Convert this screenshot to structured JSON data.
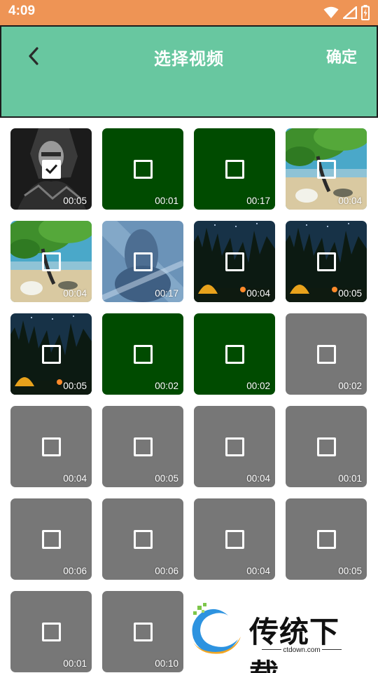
{
  "status_bar": {
    "time": "4:09"
  },
  "header": {
    "title": "选择视频",
    "confirm_label": "确定"
  },
  "colors": {
    "status_bar": "#ee9455",
    "header": "#68c7a0",
    "green_tile": "#004b00",
    "gray_tile": "#777777"
  },
  "videos": [
    {
      "duration": "00:05",
      "thumbnail": "dark-portrait",
      "selected": true
    },
    {
      "duration": "00:01",
      "thumbnail": "green",
      "selected": false
    },
    {
      "duration": "00:17",
      "thumbnail": "green",
      "selected": false
    },
    {
      "duration": "00:04",
      "thumbnail": "beach-tree",
      "selected": false
    },
    {
      "duration": "00:04",
      "thumbnail": "beach-tree",
      "selected": false
    },
    {
      "duration": "00:17",
      "thumbnail": "blue-figure",
      "selected": false
    },
    {
      "duration": "00:04",
      "thumbnail": "night-tent",
      "selected": false
    },
    {
      "duration": "00:05",
      "thumbnail": "night-tent",
      "selected": false
    },
    {
      "duration": "00:05",
      "thumbnail": "night-tent",
      "selected": false
    },
    {
      "duration": "00:02",
      "thumbnail": "green",
      "selected": false
    },
    {
      "duration": "00:02",
      "thumbnail": "green",
      "selected": false
    },
    {
      "duration": "00:02",
      "thumbnail": "gray",
      "selected": false
    },
    {
      "duration": "00:04",
      "thumbnail": "gray",
      "selected": false
    },
    {
      "duration": "00:05",
      "thumbnail": "gray",
      "selected": false
    },
    {
      "duration": "00:04",
      "thumbnail": "gray",
      "selected": false
    },
    {
      "duration": "00:01",
      "thumbnail": "gray",
      "selected": false
    },
    {
      "duration": "00:06",
      "thumbnail": "gray",
      "selected": false
    },
    {
      "duration": "00:06",
      "thumbnail": "gray",
      "selected": false
    },
    {
      "duration": "00:04",
      "thumbnail": "gray",
      "selected": false
    },
    {
      "duration": "00:05",
      "thumbnail": "gray",
      "selected": false
    },
    {
      "duration": "00:01",
      "thumbnail": "gray",
      "selected": false
    },
    {
      "duration": "00:10",
      "thumbnail": "gray",
      "selected": false
    }
  ],
  "watermark": {
    "text": "传统下载",
    "url": "ctdown.com"
  }
}
